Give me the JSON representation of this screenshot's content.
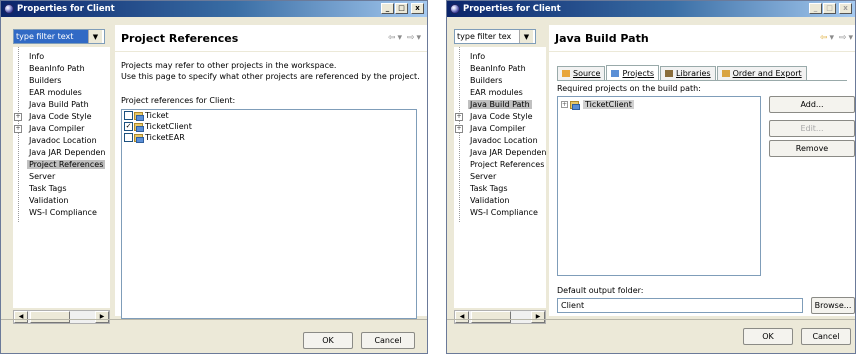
{
  "left_window": {
    "title": "Properties for Client",
    "filter_value": "type filter text",
    "nav_items": [
      {
        "label": "Info",
        "expandable": false,
        "selected": false
      },
      {
        "label": "BeanInfo Path",
        "expandable": false,
        "selected": false
      },
      {
        "label": "Builders",
        "expandable": false,
        "selected": false
      },
      {
        "label": "EAR modules",
        "expandable": false,
        "selected": false
      },
      {
        "label": "Java Build Path",
        "expandable": false,
        "selected": false
      },
      {
        "label": "Java Code Style",
        "expandable": true,
        "selected": false
      },
      {
        "label": "Java Compiler",
        "expandable": true,
        "selected": false
      },
      {
        "label": "Javadoc Location",
        "expandable": false,
        "selected": false
      },
      {
        "label": "Java JAR Dependen",
        "expandable": false,
        "selected": false
      },
      {
        "label": "Project References",
        "expandable": false,
        "selected": true
      },
      {
        "label": "Server",
        "expandable": false,
        "selected": false
      },
      {
        "label": "Task Tags",
        "expandable": false,
        "selected": false
      },
      {
        "label": "Validation",
        "expandable": false,
        "selected": false
      },
      {
        "label": "WS-I Compliance",
        "expandable": false,
        "selected": false
      }
    ],
    "page_title": "Project References",
    "description_1": "Projects may refer to other projects in the workspace.",
    "description_2": "Use this page to specify what other projects are referenced by the project.",
    "list_label": "Project references for Client:",
    "projects": [
      {
        "name": "Ticket",
        "checked": false
      },
      {
        "name": "TicketClient",
        "checked": true
      },
      {
        "name": "TicketEAR",
        "checked": false
      }
    ],
    "ok_label": "OK",
    "cancel_label": "Cancel"
  },
  "right_window": {
    "title": "Properties for Client",
    "filter_value": "type filter tex",
    "nav_items": [
      {
        "label": "Info",
        "expandable": false,
        "selected": false
      },
      {
        "label": "BeanInfo Path",
        "expandable": false,
        "selected": false
      },
      {
        "label": "Builders",
        "expandable": false,
        "selected": false
      },
      {
        "label": "EAR modules",
        "expandable": false,
        "selected": false
      },
      {
        "label": "Java Build Path",
        "expandable": false,
        "selected": true
      },
      {
        "label": "Java Code Style",
        "expandable": true,
        "selected": false
      },
      {
        "label": "Java Compiler",
        "expandable": true,
        "selected": false
      },
      {
        "label": "Javadoc Location",
        "expandable": false,
        "selected": false
      },
      {
        "label": "Java JAR Dependen",
        "expandable": false,
        "selected": false
      },
      {
        "label": "Project References",
        "expandable": false,
        "selected": false
      },
      {
        "label": "Server",
        "expandable": false,
        "selected": false
      },
      {
        "label": "Task Tags",
        "expandable": false,
        "selected": false
      },
      {
        "label": "Validation",
        "expandable": false,
        "selected": false
      },
      {
        "label": "WS-I Compliance",
        "expandable": false,
        "selected": false
      }
    ],
    "page_title": "Java Build Path",
    "tabs": [
      {
        "label": "Source",
        "active": false,
        "icon": "source-folder-icon"
      },
      {
        "label": "Projects",
        "active": true,
        "icon": "projects-icon"
      },
      {
        "label": "Libraries",
        "active": false,
        "icon": "libraries-icon"
      },
      {
        "label": "Order and Export",
        "active": false,
        "icon": "order-export-icon"
      }
    ],
    "required_label": "Required projects on the build path:",
    "required_projects": [
      "TicketClient"
    ],
    "add_label": "Add...",
    "edit_label": "Edit...",
    "remove_label": "Remove",
    "output_label": "Default output folder:",
    "output_value": "Client",
    "browse_label": "Browse...",
    "ok_label": "OK",
    "cancel_label": "Cancel"
  }
}
